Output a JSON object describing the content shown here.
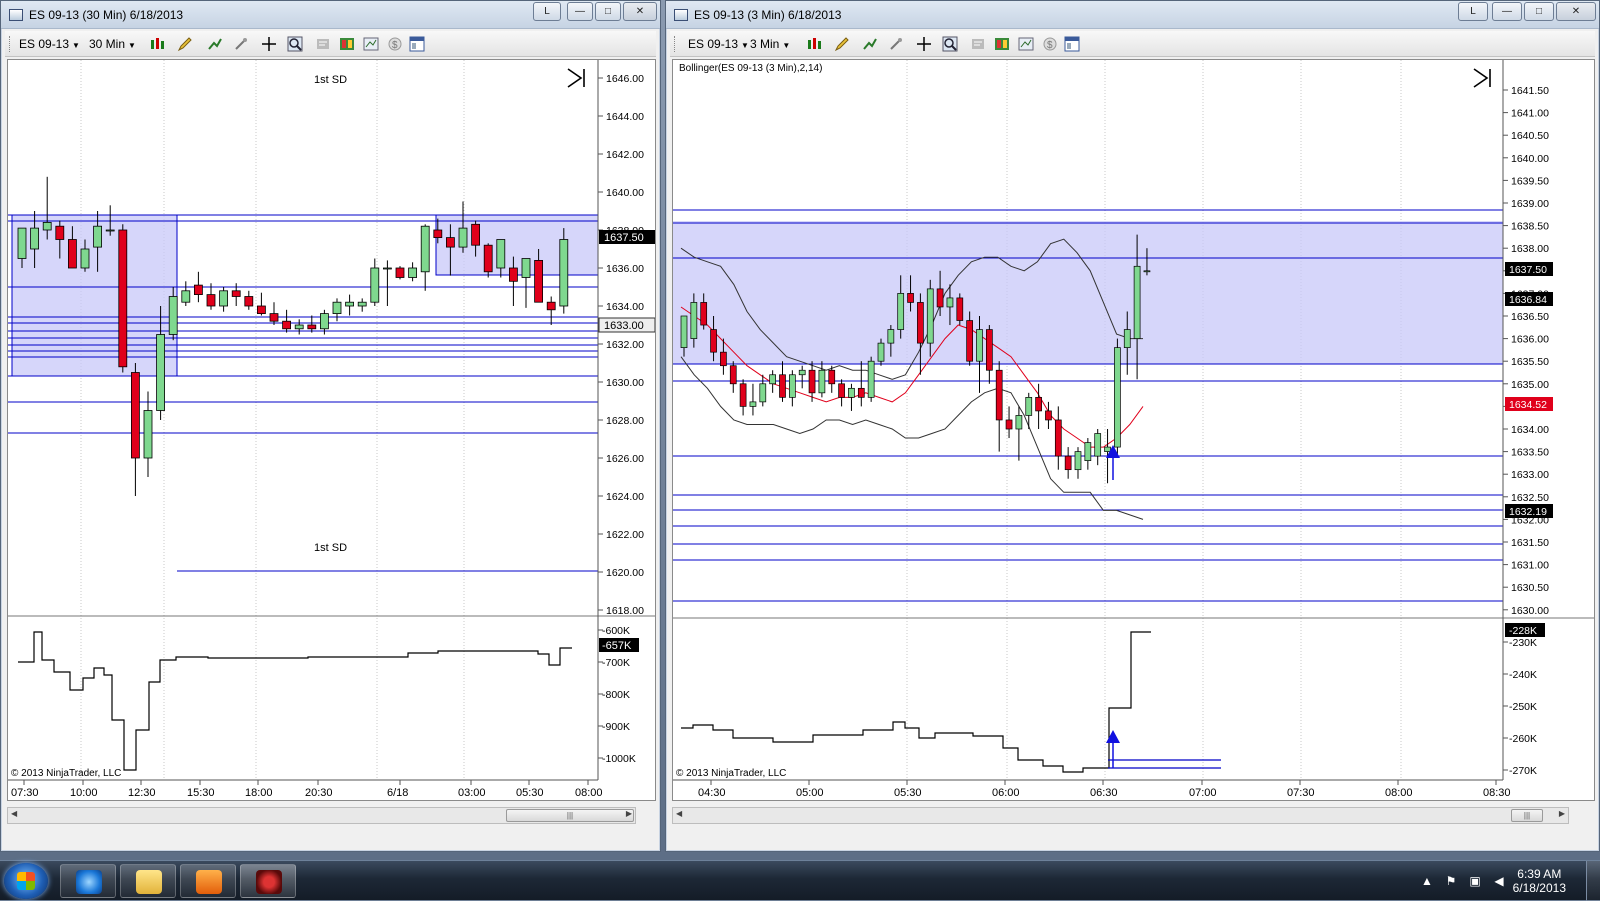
{
  "window_left": {
    "title": "ES 09-13 (30 Min)  6/18/2013",
    "buttons": {
      "link": "L",
      "minimize": "—",
      "maximize": "□",
      "close": "✕"
    },
    "toolbar": {
      "instrument": "ES 09-13",
      "interval": "30 Min"
    },
    "annotations": [
      "1st SD",
      "1st SD"
    ],
    "price_axis": [
      "1646.00",
      "1644.00",
      "1642.00",
      "1640.00",
      "1638.00",
      "1636.00",
      "1634.00",
      "1632.00",
      "1630.00",
      "1628.00",
      "1626.00",
      "1624.00",
      "1622.00",
      "1620.00",
      "1618.00"
    ],
    "price_labels": {
      "last": "1637.50",
      "marker": "1633.00"
    },
    "volume_axis": [
      "-600K",
      "-700K",
      "-800K",
      "-900K",
      "-1000K"
    ],
    "volume_label": "-657K",
    "time_axis": [
      "07:30",
      "10:00",
      "12:30",
      "15:30",
      "18:00",
      "20:30",
      "6/18",
      "03:00",
      "05:30",
      "08:00"
    ],
    "copyright": "© 2013 NinjaTrader, LLC"
  },
  "window_right": {
    "title": "ES 09-13 (3 Min)  6/18/2013",
    "buttons": {
      "link": "L",
      "minimize": "—",
      "maximize": "□",
      "close": "✕"
    },
    "toolbar": {
      "instrument": "ES 09-13",
      "interval": "3 Min"
    },
    "indicator_label": "Bollinger(ES 09-13 (3 Min),2,14)",
    "price_axis": [
      "1641.50",
      "1641.00",
      "1640.50",
      "1640.00",
      "1639.50",
      "1639.00",
      "1638.50",
      "1638.00",
      "1637.50",
      "1637.00",
      "1636.50",
      "1636.00",
      "1635.50",
      "1635.00",
      "1634.50",
      "1634.00",
      "1633.50",
      "1633.00",
      "1632.50",
      "1632.00",
      "1631.50",
      "1631.00",
      "1630.50",
      "1630.00"
    ],
    "price_labels": {
      "last": "1637.50",
      "upper": "1636.84",
      "middle": "1634.52",
      "lower": "1632.19"
    },
    "volume_axis": [
      "-230K",
      "-240K",
      "-250K",
      "-260K",
      "-270K"
    ],
    "volume_label": "-228K",
    "time_axis": [
      "04:30",
      "05:00",
      "05:30",
      "06:00",
      "06:30",
      "07:00",
      "07:30",
      "08:00",
      "08:30"
    ],
    "copyright": "© 2013 NinjaTrader, LLC"
  },
  "taskbar": {
    "time": "6:39 AM",
    "date": "6/18/2013"
  },
  "colors": {
    "bull": "#7fd88f",
    "bear": "#e0001b",
    "zone": "#c8c8f8",
    "level": "#0000c8",
    "accent_red": "#e0001b"
  }
}
